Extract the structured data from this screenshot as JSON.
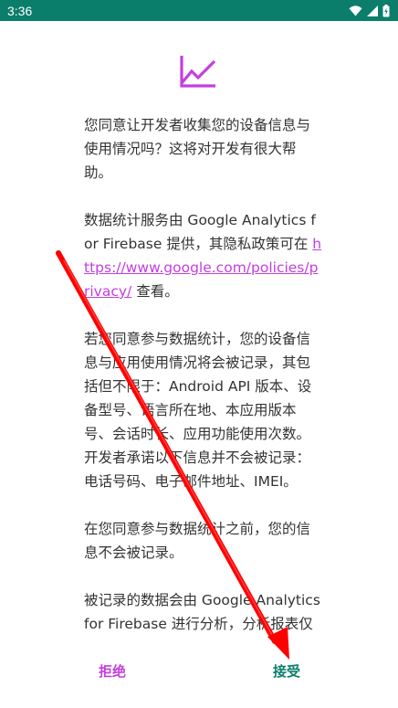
{
  "status_bar": {
    "time": "3:36",
    "icons": [
      "wifi-icon",
      "cell-signal-icon",
      "battery-icon"
    ]
  },
  "dialog": {
    "icon": "line-chart-icon",
    "paragraphs": {
      "p1": "您同意让开发者收集您的设备信息与使用情况吗？这将对开发有很大帮助。",
      "p2_before": "数据统计服务由 Google Analytics for Firebase 提供，其隐私政策可在 ",
      "p2_link": "https://www.google.com/policies/privacy/",
      "p2_after": " 查看。",
      "p3": "若您同意参与数据统计，您的设备信息与应用使用情况将会被记录，其包括但不限于：Android API 版本、设备型号、语言所在地、本应用版本号、会话时长、应用功能使用次数。开发者承诺以下信息并不会被记录：电话号码、电子邮件地址、IMEI。",
      "p4": "在您同意参与数据统计之前，您的信息不会被记录。",
      "p5": "被记录的数据会由 Google Analytics for Firebase 进行分析，分析报表仅"
    },
    "buttons": {
      "reject": "拒绝",
      "accept": "接受"
    }
  },
  "colors": {
    "status_bar": "#0a7e6b",
    "accent_purple": "#c43ee0",
    "accent_teal": "#0a7e6b",
    "annotation_arrow": "#ff0000"
  }
}
